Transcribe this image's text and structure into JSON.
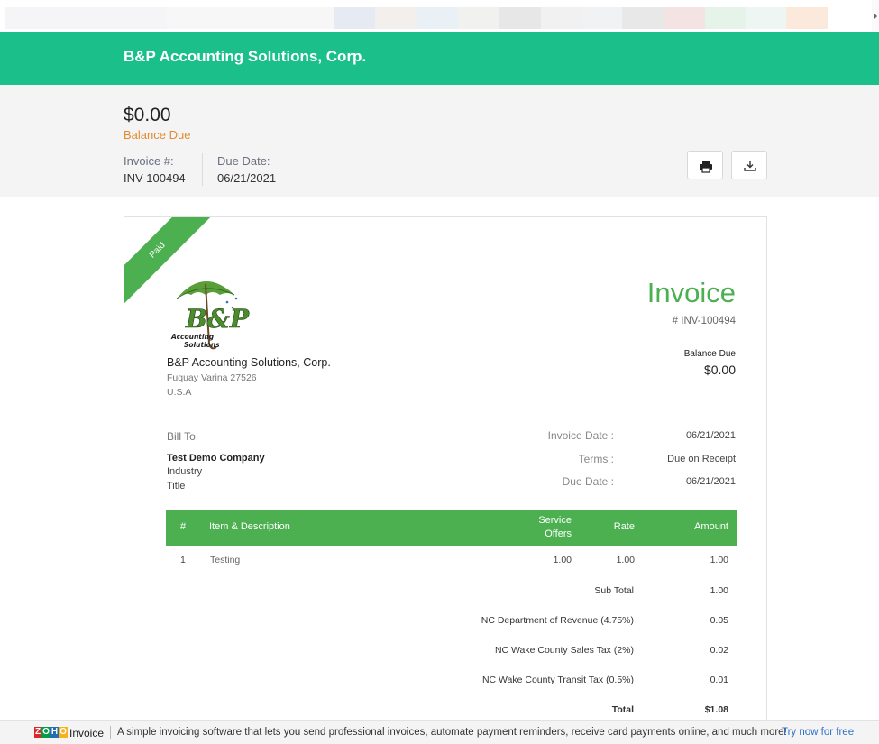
{
  "brandbar": {
    "org_name": "B&P Accounting Solutions, Corp."
  },
  "summary": {
    "amount": "$0.00",
    "balance_label": "Balance Due",
    "invoice_label": "Invoice #:",
    "invoice_value": "INV-100494",
    "due_label": "Due Date:",
    "due_value": "06/21/2021",
    "icons": [
      "printer-icon",
      "download-icon"
    ]
  },
  "invoice": {
    "status_ribbon": "Paid",
    "title": "Invoice",
    "number": "# INV-100494",
    "balance_label": "Balance Due",
    "balance_value": "$0.00",
    "logo_text": {
      "main": "B&P",
      "sub1": "Accounting",
      "sub2": "Solutions"
    },
    "from": {
      "name": "B&P Accounting Solutions, Corp.",
      "city": "Fuquay Varina  27526",
      "country": "U.S.A"
    },
    "bill_to": {
      "label": "Bill To",
      "name": "Test Demo Company",
      "line1": "Industry",
      "line2": "Title"
    },
    "details": [
      {
        "label": "Invoice Date :",
        "value": "06/21/2021"
      },
      {
        "label": "Terms :",
        "value": "Due on Receipt"
      },
      {
        "label": "Due Date :",
        "value": "06/21/2021"
      }
    ],
    "table": {
      "headers": {
        "num": "#",
        "item": "Item & Description",
        "qty_1": "Service",
        "qty_2": "Offers",
        "rate": "Rate",
        "amount": "Amount"
      },
      "rows": [
        {
          "num": "1",
          "item": "Testing",
          "qty": "1.00",
          "rate": "1.00",
          "amount": "1.00"
        }
      ]
    },
    "totals": [
      {
        "label": "Sub Total",
        "value": "1.00"
      },
      {
        "label": "NC Department of Revenue (4.75%)",
        "value": "0.05"
      },
      {
        "label": "NC Wake County Sales Tax (2%)",
        "value": "0.02"
      },
      {
        "label": "NC Wake County Transit Tax (0.5%)",
        "value": "0.01"
      },
      {
        "label": "Total",
        "value": "$1.08"
      }
    ]
  },
  "footer": {
    "brand_letters": [
      "Z",
      "O",
      "H",
      "O"
    ],
    "product": "Invoice",
    "promo": "A simple invoicing software that lets you send professional invoices, automate payment reminders, receive card payments online, and much more!",
    "cta": "Try now for free"
  },
  "colors": {
    "brand": "#1bbf8a",
    "accent": "#4caf50",
    "balance": "#e28b2e",
    "link": "#2f71c5"
  }
}
